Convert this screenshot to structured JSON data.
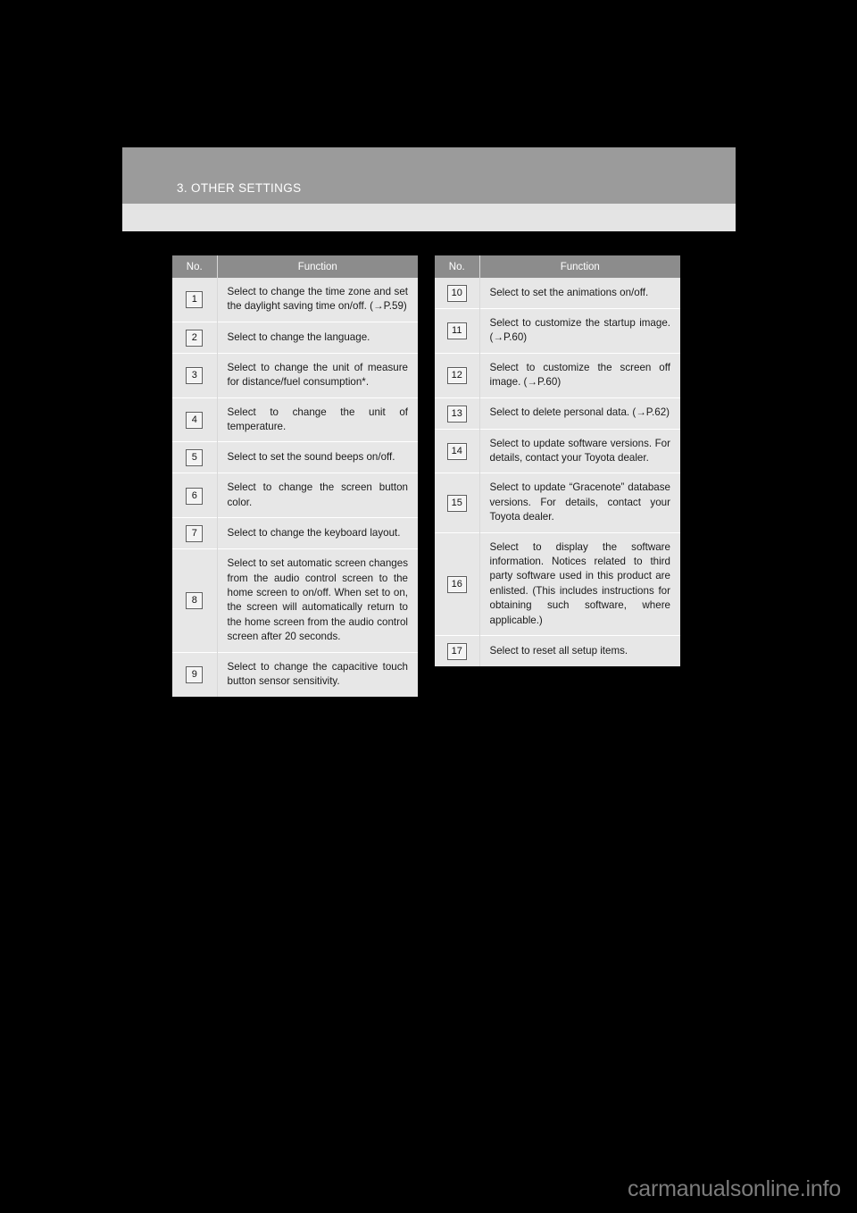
{
  "page": {
    "chapter_title": "3. OTHER SETTINGS",
    "watermark": "carmanualsonline.info"
  },
  "tables": {
    "left": {
      "headers": {
        "no": "No.",
        "function": "Function"
      },
      "rows": [
        {
          "no": "1",
          "text": "Select to change the time zone and set the daylight saving time on/off. (→P.59)"
        },
        {
          "no": "2",
          "text": "Select to change the language."
        },
        {
          "no": "3",
          "text": "Select to change the unit of measure for distance/fuel consumption*."
        },
        {
          "no": "4",
          "text": "Select to change the unit of temperature."
        },
        {
          "no": "5",
          "text": "Select to set the sound beeps on/off."
        },
        {
          "no": "6",
          "text": "Select to change the screen button color."
        },
        {
          "no": "7",
          "text": "Select to change the keyboard layout."
        },
        {
          "no": "8",
          "text": "Select to set automatic screen changes from the audio control screen to the home screen to on/off. When set to on, the screen will automatically return to the home screen from the audio control screen after 20 seconds."
        },
        {
          "no": "9",
          "text": "Select to change the capacitive touch button sensor sensitivity."
        }
      ]
    },
    "right": {
      "headers": {
        "no": "No.",
        "function": "Function"
      },
      "rows": [
        {
          "no": "10",
          "text": "Select to set the animations on/off."
        },
        {
          "no": "11",
          "text": "Select to customize the startup image. (→P.60)"
        },
        {
          "no": "12",
          "text": "Select to customize the screen off image. (→P.60)"
        },
        {
          "no": "13",
          "text": "Select to delete personal data. (→P.62)"
        },
        {
          "no": "14",
          "text": "Select to update software versions. For details, contact your Toyota dealer."
        },
        {
          "no": "15",
          "text": "Select to update “Gracenote” database versions. For details, contact your Toyota dealer."
        },
        {
          "no": "16",
          "text": "Select to display the software information. Notices related to third party software used in this product are enlisted. (This includes instructions for obtaining such software, where applicable.)"
        },
        {
          "no": "17",
          "text": "Select to reset all setup items."
        }
      ]
    }
  },
  "colors": {
    "band_dark": "#9b9b9b",
    "band_light": "#e4e4e4",
    "table_header": "#8c8c8c",
    "table_body": "#e7e7e7",
    "page_background": "#000000"
  }
}
